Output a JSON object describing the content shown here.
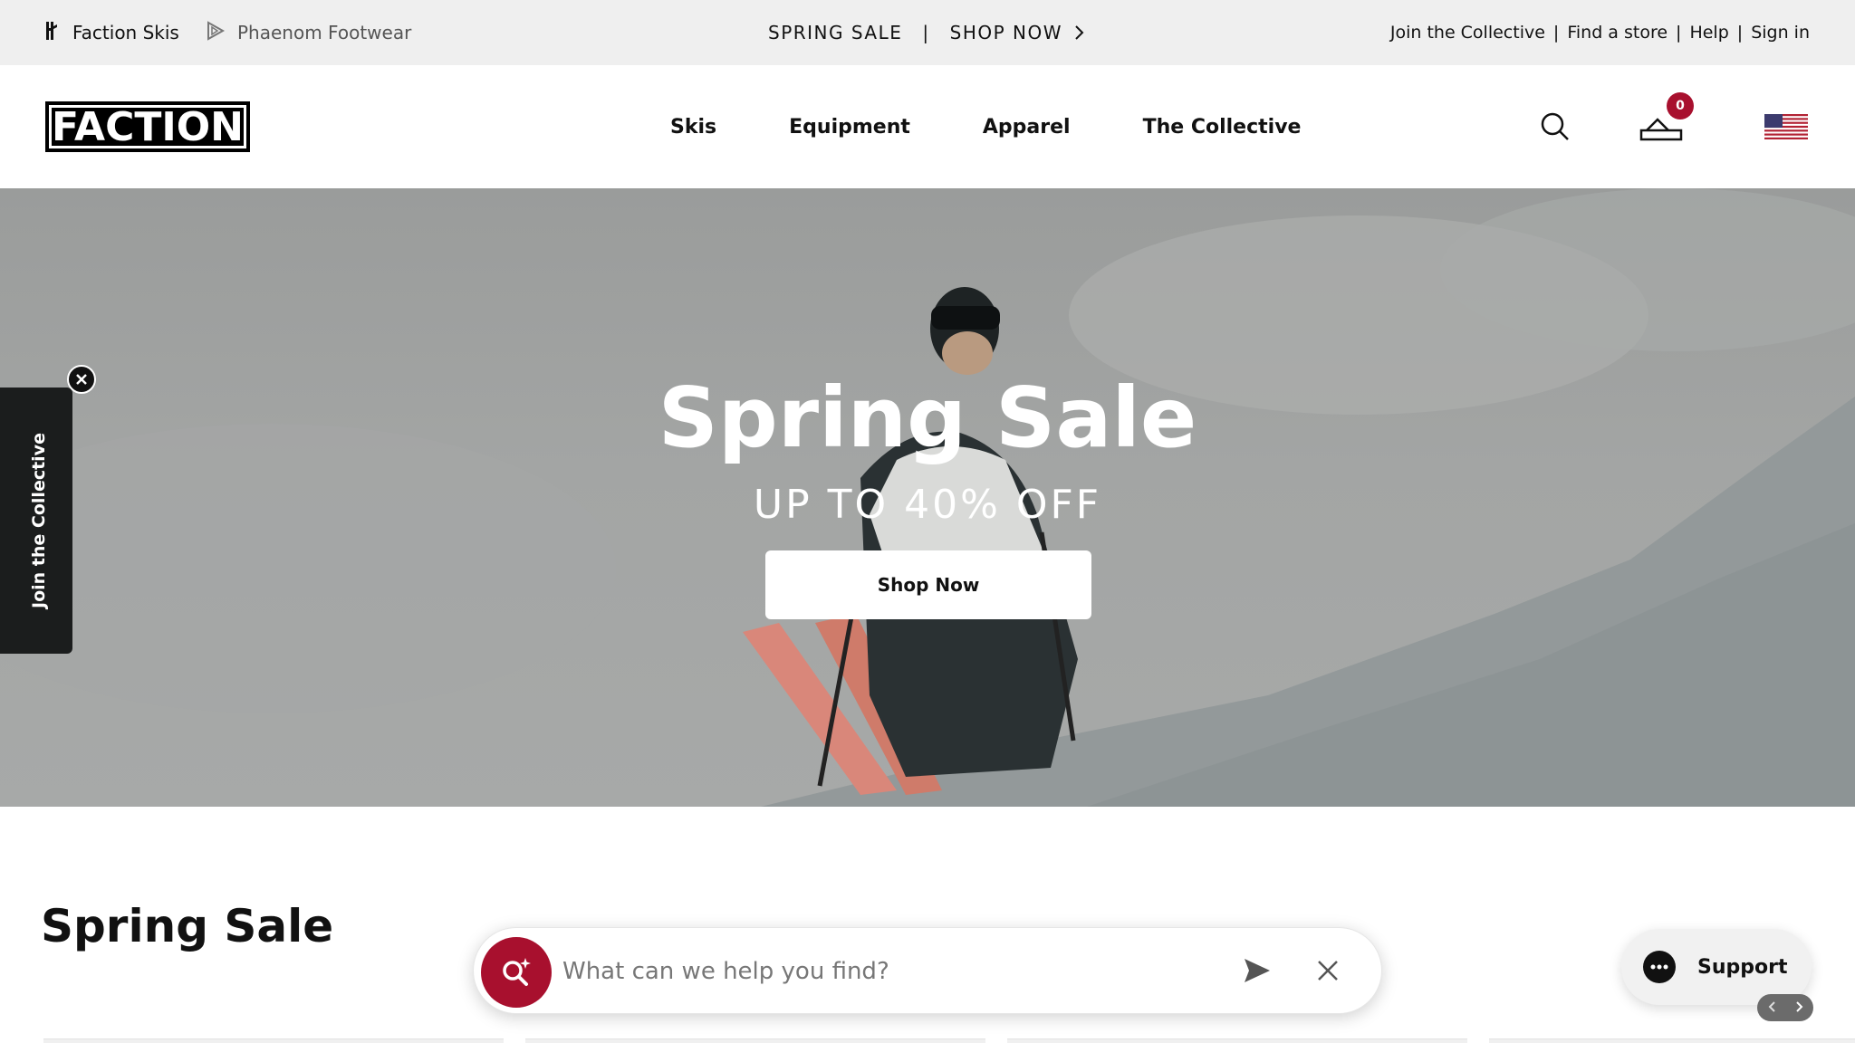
{
  "topbar": {
    "brand_primary": "Faction Skis",
    "brand_secondary": "Phaenom Footwear",
    "promo_left": "SPRING SALE",
    "promo_sep": "|",
    "promo_right": "SHOP NOW",
    "links": [
      "Join the Collective",
      "Find a store",
      "Help",
      "Sign in"
    ],
    "link_sep": "|"
  },
  "header": {
    "logo_text": "FACTION",
    "nav": [
      "Skis",
      "Equipment",
      "Apparel",
      "The Collective"
    ],
    "cart_count": "0",
    "icons": {
      "search": "search-icon",
      "cart": "cart-icon",
      "flag": "us-flag-icon"
    }
  },
  "hero": {
    "title": "Spring Sale",
    "subtitle": "UP TO 40% OFF",
    "cta": "Shop Now"
  },
  "side_tab": {
    "label": "Join the Collective"
  },
  "section": {
    "title": "Spring Sale"
  },
  "assistant": {
    "placeholder": "What can we help you find?"
  },
  "support": {
    "label": "Support"
  },
  "colors": {
    "accent": "#a8102e",
    "topbar_bg": "#efefef",
    "side_tab_bg": "#1b1d1d"
  }
}
